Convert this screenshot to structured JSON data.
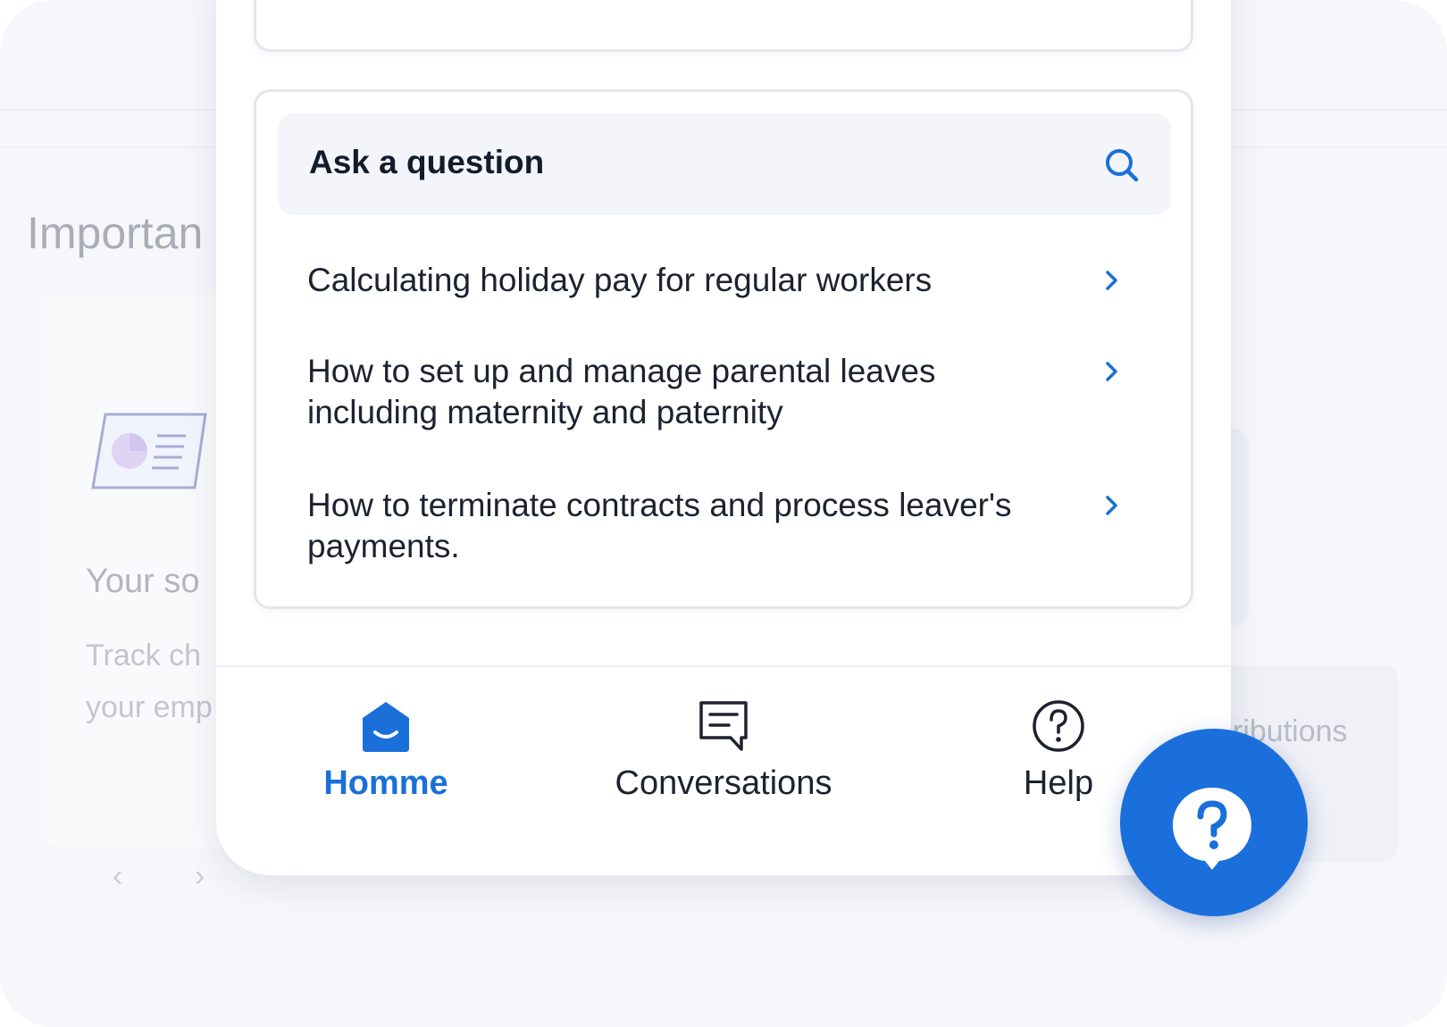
{
  "background": {
    "section_title": "Importan",
    "card_title": "Your so",
    "card_desc_line1": "Track ch",
    "card_desc_line2": "your emp",
    "right_card_text": "ributions",
    "prev_arrow": "‹",
    "next_arrow": "›"
  },
  "help_card": {
    "search_label": "Ask a question",
    "search_icon": "search-icon",
    "articles": [
      {
        "title": "Calculating holiday pay for regular workers"
      },
      {
        "title": "How to set up and manage parental leaves including maternity and paternity"
      },
      {
        "title": "How to terminate contracts and process leaver's payments."
      }
    ]
  },
  "nav": {
    "items": [
      {
        "label": "Homme",
        "icon": "home-icon",
        "active": true
      },
      {
        "label": "Conversations",
        "icon": "chat-icon",
        "active": false
      },
      {
        "label": "Help",
        "icon": "help-circle-icon",
        "active": false
      }
    ]
  },
  "launcher": {
    "icon": "question-bubble-icon"
  },
  "colors": {
    "accent": "#1a70d8",
    "launcher_bg": "#1a6fdc",
    "text": "#1d2230",
    "search_bg": "#f4f5fa"
  }
}
